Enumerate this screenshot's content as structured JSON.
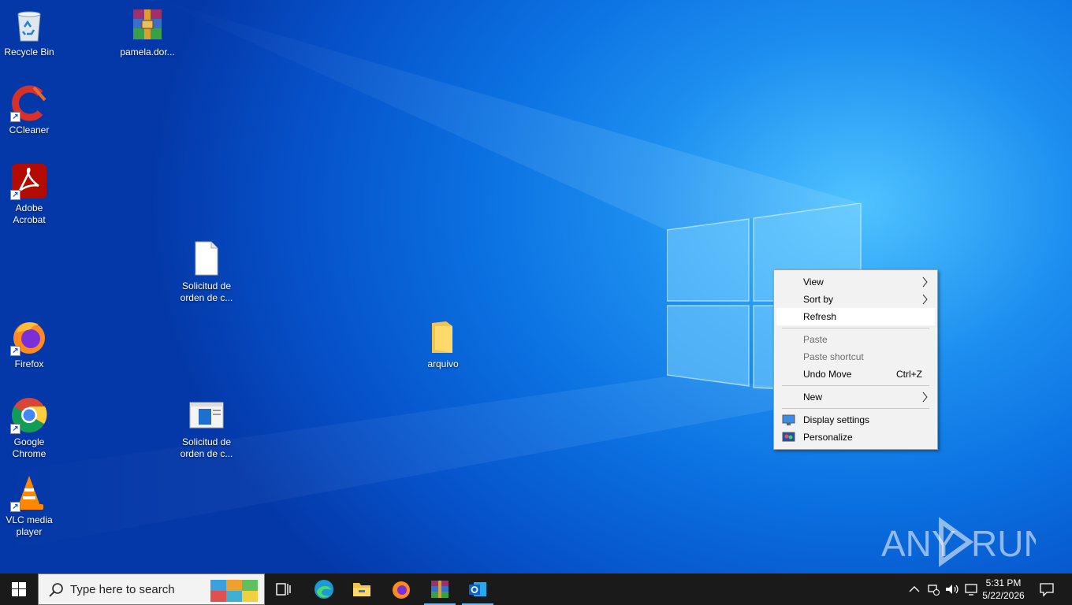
{
  "desktop": {
    "icons": [
      {
        "label": "Recycle Bin",
        "icon": "recycle-bin-icon"
      },
      {
        "label": "pamela.dor...",
        "icon": "winrar-archive-icon"
      },
      {
        "label": "CCleaner",
        "icon": "ccleaner-icon"
      },
      {
        "label": "Adobe Acrobat",
        "icon": "adobe-acrobat-icon"
      },
      {
        "label": "Solicitud de orden de c...",
        "icon": "blank-file-icon"
      },
      {
        "label": "Firefox",
        "icon": "firefox-icon"
      },
      {
        "label": "arquivo",
        "icon": "folder-icon"
      },
      {
        "label": "Google Chrome",
        "icon": "chrome-icon"
      },
      {
        "label": "Solicitud de orden de c...",
        "icon": "document-window-icon"
      },
      {
        "label": "VLC media player",
        "icon": "vlc-icon"
      }
    ]
  },
  "context_menu": {
    "items": [
      {
        "label": "View",
        "submenu": true
      },
      {
        "label": "Sort by",
        "submenu": true
      },
      {
        "label": "Refresh",
        "highlighted": true
      },
      {
        "label": "Paste",
        "disabled": true
      },
      {
        "label": "Paste shortcut",
        "disabled": true
      },
      {
        "label": "Undo Move",
        "accelerator": "Ctrl+Z"
      },
      {
        "label": "New",
        "submenu": true
      },
      {
        "label": "Display settings",
        "icon": "display-settings-icon"
      },
      {
        "label": "Personalize",
        "icon": "personalize-icon"
      }
    ]
  },
  "taskbar": {
    "search_placeholder": "Type here to search",
    "apps": [
      "task-view-icon",
      "edge-icon",
      "file-explorer-icon",
      "firefox-icon",
      "winrar-icon",
      "outlook-icon"
    ],
    "clock": {
      "time": "5:31 PM",
      "date": "5/22/2026"
    }
  },
  "watermark": "ANY RUN",
  "colors": {
    "taskbar": "#1a1a1a",
    "menu_bg": "#f2f2f2",
    "accent": "#76b9ed"
  }
}
